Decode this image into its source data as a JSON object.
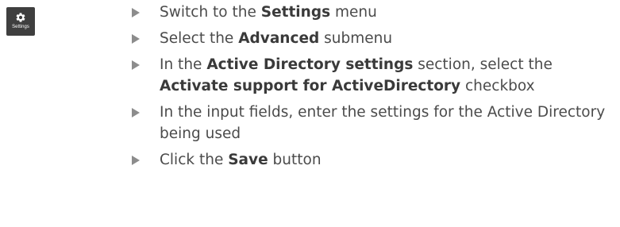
{
  "icon": {
    "name": "gear-icon",
    "label": "Settings",
    "background": "#3f3f3f"
  },
  "steps": [
    {
      "before": "Switch to the ",
      "bold": "Settings",
      "after": " menu"
    },
    {
      "before": "Select the ",
      "bold": "Advanced",
      "after": " submenu"
    },
    {
      "before": "In the ",
      "bold": "Active Directory settings",
      "mid": " section, select the ",
      "bold2": "Activate support for ActiveDirectory",
      "after": " checkbox"
    },
    {
      "before": "In the input fields, enter the settings for the Active Directory being used"
    },
    {
      "before": "Click the ",
      "bold": "Save",
      "after": " button"
    }
  ],
  "colors": {
    "text": "#4b4b4b",
    "bullet": "#8c8c8c"
  }
}
